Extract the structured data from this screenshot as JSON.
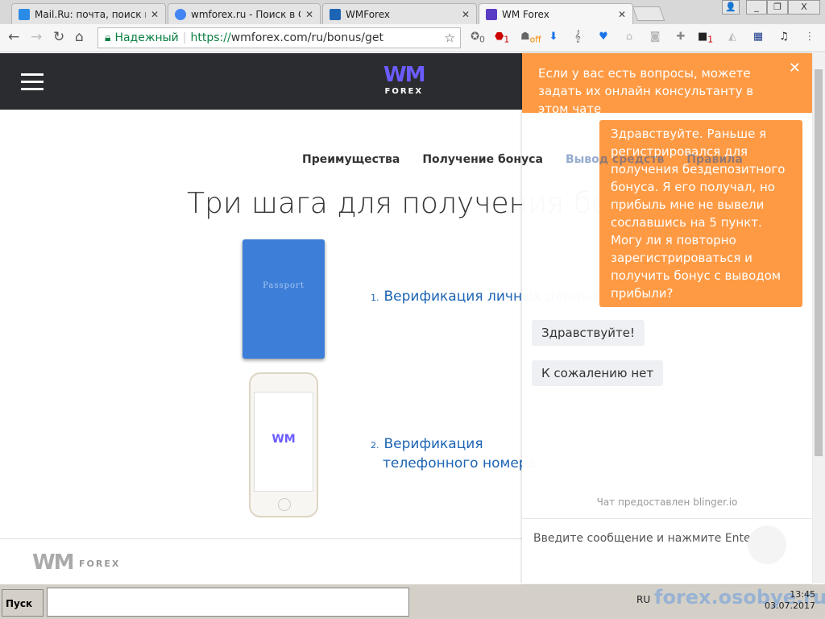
{
  "browser": {
    "tabs": [
      {
        "label": "Mail.Ru: почта, поиск в ин",
        "color": "#2a8ce6"
      },
      {
        "label": "wmforex.ru - Поиск в Goog",
        "color": "#4285f4"
      },
      {
        "label": "WMForex",
        "color": "#1d64b4"
      },
      {
        "label": "WM Forex",
        "color": "#5b3cc4"
      }
    ],
    "secure_label": "Надежный",
    "url_scheme": "https://",
    "url_rest": "wmforex.com/ru/bonus/get",
    "ext_badges": [
      "0",
      "1",
      "off",
      "1"
    ]
  },
  "site": {
    "logo_mark": "WM",
    "logo_text": "FOREX",
    "menu": [
      "Преимущества",
      "Получение бонуса",
      "Вывод средств",
      "Правила"
    ],
    "title": "Три шага для получения бонуса",
    "passport_label": "Passport",
    "phone_logo": "WM",
    "steps": [
      {
        "n": "1.",
        "text": "Верификация личных данных"
      },
      {
        "n": "2.",
        "text": "Верификация",
        "text2": "телефонного номера"
      }
    ],
    "footer_logo": "WM",
    "footer_text": "FOREX"
  },
  "chat": {
    "header": "Если у вас есть вопросы, можете задать их онлайн консультанту в этом чате",
    "close": "✕",
    "messages": [
      {
        "from": "user",
        "text": "Здравствуйте. Раньше я регистрировался для получения бездепозитного бонуса. Я его получал, но прибыль мне не вывели сославшись на 5 пункт. Могу ли я повторно зарегистрироваться и получить бонус с выводом прибыли?"
      },
      {
        "from": "agent",
        "text": "Здравствуйте!"
      },
      {
        "from": "agent",
        "text": "К сожалению нет"
      }
    ],
    "powered": "Чат предоставлен blinger.io",
    "placeholder": "Введите сообщение и нажмите Enter"
  },
  "taskbar": {
    "start": "Пуск",
    "lang": "RU",
    "time": "13:45",
    "date": "03.07.2017",
    "watermark": "forex.osobye.ru"
  }
}
